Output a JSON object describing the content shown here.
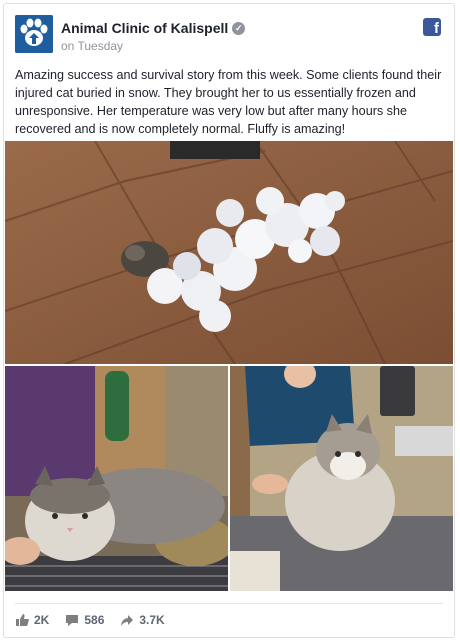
{
  "post": {
    "page_name": "Animal Clinic of Kalispell",
    "timestamp": "on Tuesday",
    "text": "Amazing success and survival story from this week. Some clients found their injured cat buried in snow. They brought her to us essentially frozen and unresponsive. Her temperature was very low but after many hours she recovered and is now completely normal. Fluffy is amazing!"
  },
  "photos": [
    {
      "icon": "frozen-cat-photo"
    },
    {
      "icon": "cat-drying-photo"
    },
    {
      "icon": "cat-recovered-photo"
    }
  ],
  "engagement": {
    "likes": "2K",
    "comments": "586",
    "shares": "3.7K"
  },
  "colors": {
    "brand_blue": "#3b5998",
    "meta_gray": "#90949c",
    "action_gray": "#606770"
  }
}
